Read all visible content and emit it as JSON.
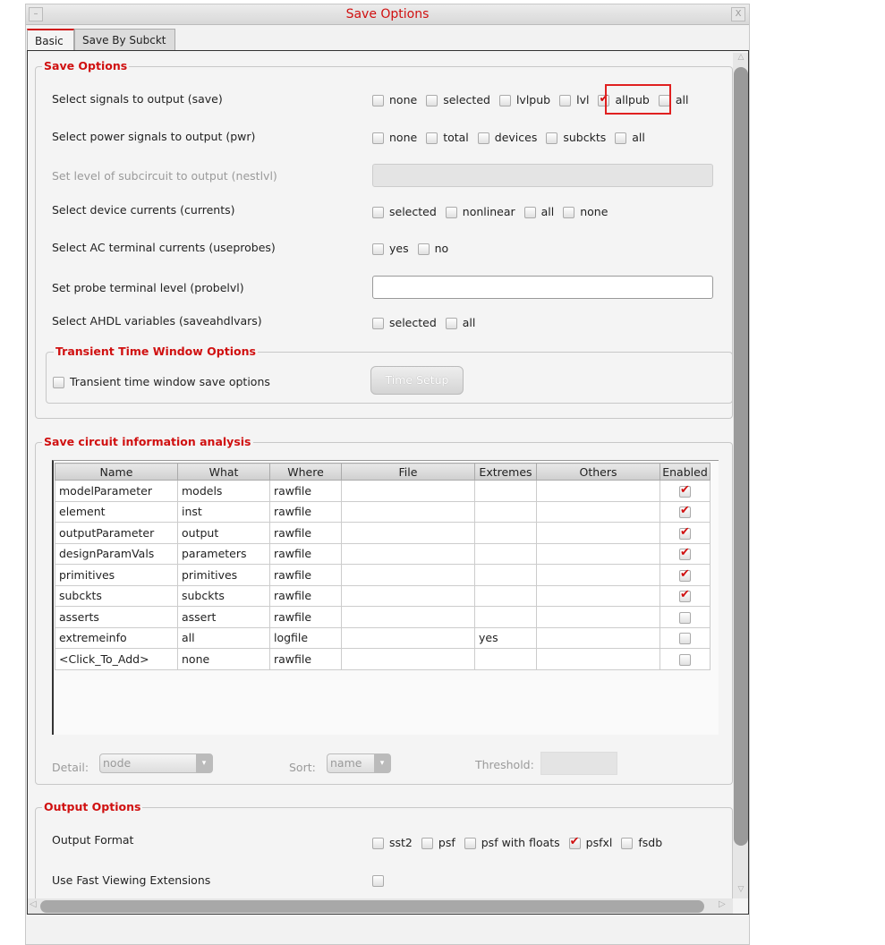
{
  "window": {
    "title": "Save Options",
    "minimize": "–",
    "close": "X"
  },
  "tabs": [
    {
      "label": "Basic",
      "active": true
    },
    {
      "label": "Save By Subckt",
      "active": false
    }
  ],
  "save_options": {
    "legend": "Save Options",
    "signals": {
      "label": "Select signals to output (save)",
      "options": [
        {
          "label": "none",
          "checked": false
        },
        {
          "label": "selected",
          "checked": false
        },
        {
          "label": "lvlpub",
          "checked": false
        },
        {
          "label": "lvl",
          "checked": false
        },
        {
          "label": "allpub",
          "checked": true,
          "highlighted": true
        },
        {
          "label": "all",
          "checked": false
        }
      ]
    },
    "power": {
      "label": "Select power signals to output (pwr)",
      "options": [
        {
          "label": "none",
          "checked": false
        },
        {
          "label": "total",
          "checked": false
        },
        {
          "label": "devices",
          "checked": false
        },
        {
          "label": "subckts",
          "checked": false
        },
        {
          "label": "all",
          "checked": false
        }
      ]
    },
    "nestlvl": {
      "label": "Set level of subcircuit to output (nestlvl)",
      "value": ""
    },
    "currents": {
      "label": "Select device currents (currents)",
      "options": [
        {
          "label": "selected",
          "checked": false
        },
        {
          "label": "nonlinear",
          "checked": false
        },
        {
          "label": "all",
          "checked": false
        },
        {
          "label": "none",
          "checked": false
        }
      ]
    },
    "useprobes": {
      "label": "Select AC terminal currents (useprobes)",
      "options": [
        {
          "label": "yes",
          "checked": false
        },
        {
          "label": "no",
          "checked": false
        }
      ]
    },
    "probelvl": {
      "label": "Set probe terminal level (probelvl)",
      "value": ""
    },
    "ahdl": {
      "label": "Select AHDL variables (saveahdlvars)",
      "options": [
        {
          "label": "selected",
          "checked": false
        },
        {
          "label": "all",
          "checked": false
        }
      ]
    },
    "transient": {
      "legend": "Transient Time Window Options",
      "checkbox_label": "Transient time window save options",
      "checked": false,
      "button": "Time Setup"
    }
  },
  "circuit_info": {
    "legend": "Save circuit information analysis",
    "columns": [
      "Name",
      "What",
      "Where",
      "File",
      "Extremes",
      "Others",
      "Enabled"
    ],
    "rows": [
      [
        "modelParameter",
        "models",
        "rawfile",
        "",
        "",
        "",
        true
      ],
      [
        "element",
        "inst",
        "rawfile",
        "",
        "",
        "",
        true
      ],
      [
        "outputParameter",
        "output",
        "rawfile",
        "",
        "",
        "",
        true
      ],
      [
        "designParamVals",
        "parameters",
        "rawfile",
        "",
        "",
        "",
        true
      ],
      [
        "primitives",
        "primitives",
        "rawfile",
        "",
        "",
        "",
        true
      ],
      [
        "subckts",
        "subckts",
        "rawfile",
        "",
        "",
        "",
        true
      ],
      [
        "asserts",
        "assert",
        "rawfile",
        "",
        "",
        "",
        false
      ],
      [
        "extremeinfo",
        "all",
        "logfile",
        "",
        "yes",
        "",
        false
      ],
      [
        "<Click_To_Add>",
        "none",
        "rawfile",
        "",
        "",
        "",
        false
      ]
    ],
    "detail_label": "Detail:",
    "detail_value": "node",
    "sort_label": "Sort:",
    "sort_value": "name",
    "threshold_label": "Threshold:",
    "threshold_value": ""
  },
  "output_options": {
    "legend": "Output Options",
    "format": {
      "label": "Output Format",
      "options": [
        {
          "label": "sst2",
          "checked": false
        },
        {
          "label": "psf",
          "checked": false
        },
        {
          "label": "psf with floats",
          "checked": false
        },
        {
          "label": "psfxl",
          "checked": true
        },
        {
          "label": "fsdb",
          "checked": false
        }
      ]
    },
    "fast_viewing": {
      "label": "Use Fast Viewing Extensions",
      "checked": false
    }
  },
  "colors": {
    "accent": "#d01010"
  }
}
